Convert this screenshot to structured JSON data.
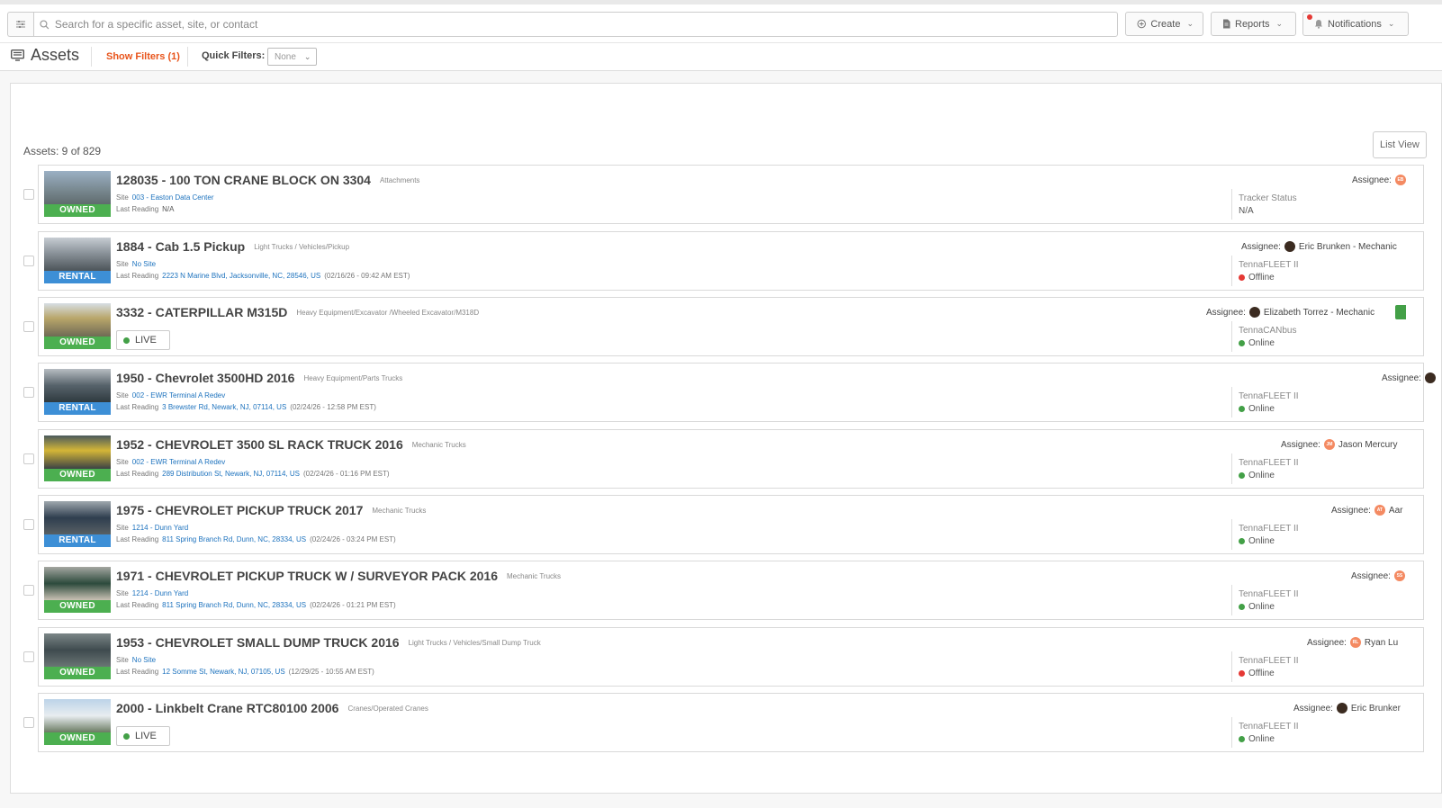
{
  "topbar": {
    "search_placeholder": "Search for a specific asset, site, or contact",
    "create_label": "Create",
    "reports_label": "Reports",
    "notifications_label": "Notifications"
  },
  "subbar": {
    "title": "Assets",
    "show_filters": "Show Filters (1)",
    "quick_filters_label": "Quick Filters:",
    "quick_filters_value": "None"
  },
  "panel": {
    "count": "Assets: 9 of 829",
    "list_view": "List View"
  },
  "labels": {
    "site": "Site",
    "last_reading": "Last Reading",
    "assignee": "Assignee:",
    "live": "LIVE"
  },
  "assets": [
    {
      "name": "128035 - 100 TON CRANE BLOCK ON 3304",
      "category": "Attachments",
      "ownership": "OWNED",
      "site": "003 - Easton Data Center",
      "reading": "N/A",
      "reading_time": "",
      "tracker": "Tracker Status",
      "status": "N/A",
      "assignee": "",
      "avatar": "EB"
    },
    {
      "name": "1884 - Cab 1.5 Pickup",
      "category": "Light Trucks / Vehicles/Pickup",
      "ownership": "RENTAL",
      "site": "No Site",
      "reading": "2223 N Marine Blvd, Jacksonville, NC, 28546, US",
      "reading_time": "(02/16/26 - 09:42 AM EST)",
      "tracker": "TennaFLEET II",
      "status": "Offline",
      "assignee": "Eric Brunken - Mechanic",
      "avatar": ""
    },
    {
      "name": "3332 - CATERPILLAR M315D",
      "category": "Heavy Equipment/Excavator /Wheeled Excavator/M318D",
      "ownership": "OWNED",
      "site": "",
      "reading": "",
      "reading_time": "",
      "tracker": "TennaCANbus",
      "status": "Online",
      "assignee": "Elizabeth Torrez - Mechanic",
      "avatar": ""
    },
    {
      "name": "1950 - Chevrolet 3500HD 2016",
      "category": "Heavy Equipment/Parts Trucks",
      "ownership": "RENTAL",
      "site": "002 - EWR Terminal A Redev",
      "reading": "3 Brewster Rd, Newark, NJ, 07114, US",
      "reading_time": "(02/24/26 - 12:58 PM EST)",
      "tracker": "TennaFLEET II",
      "status": "Online",
      "assignee": "",
      "avatar": ""
    },
    {
      "name": "1952 - CHEVROLET 3500 SL RACK TRUCK 2016",
      "category": "Mechanic Trucks",
      "ownership": "OWNED",
      "site": "002 - EWR Terminal A Redev",
      "reading": "289 Distribution St, Newark, NJ, 07114, US",
      "reading_time": "(02/24/26 - 01:16 PM EST)",
      "tracker": "TennaFLEET II",
      "status": "Online",
      "assignee": "Jason Mercury",
      "avatar": "JM"
    },
    {
      "name": "1975 - CHEVROLET PICKUP TRUCK 2017",
      "category": "Mechanic Trucks",
      "ownership": "RENTAL",
      "site": "1214 - Dunn Yard",
      "reading": "811 Spring Branch Rd, Dunn, NC, 28334, US",
      "reading_time": "(02/24/26 - 03:24 PM EST)",
      "tracker": "TennaFLEET II",
      "status": "Online",
      "assignee": "Aar",
      "avatar": "AT"
    },
    {
      "name": "1971 - CHEVROLET PICKUP TRUCK W / SURVEYOR PACK 2016",
      "category": "Mechanic Trucks",
      "ownership": "OWNED",
      "site": "1214 - Dunn Yard",
      "reading": "811 Spring Branch Rd, Dunn, NC, 28334, US",
      "reading_time": "(02/24/26 - 01:21 PM EST)",
      "tracker": "TennaFLEET II",
      "status": "Online",
      "assignee": "",
      "avatar": "SS"
    },
    {
      "name": "1953 - CHEVROLET SMALL DUMP TRUCK 2016",
      "category": "Light Trucks / Vehicles/Small Dump Truck",
      "ownership": "OWNED",
      "site": "No Site",
      "reading": "12 Somme St, Newark, NJ, 07105, US",
      "reading_time": "(12/29/25 - 10:55 AM EST)",
      "tracker": "TennaFLEET II",
      "status": "Offline",
      "assignee": "Ryan Lu",
      "avatar": "RL"
    },
    {
      "name": "2000 - Linkbelt Crane RTC80100 2006",
      "category": "Cranes/Operated Cranes",
      "ownership": "OWNED",
      "site": "",
      "reading": "",
      "reading_time": "",
      "tracker": "TennaFLEET II",
      "status": "Online",
      "assignee": "Eric Brunker",
      "avatar": ""
    }
  ],
  "colors": {
    "owned": "#4caf50",
    "rental": "#3d8fd6",
    "link": "#1e73be",
    "accent": "#e8541b",
    "online": "#43a047",
    "offline": "#e53935"
  }
}
